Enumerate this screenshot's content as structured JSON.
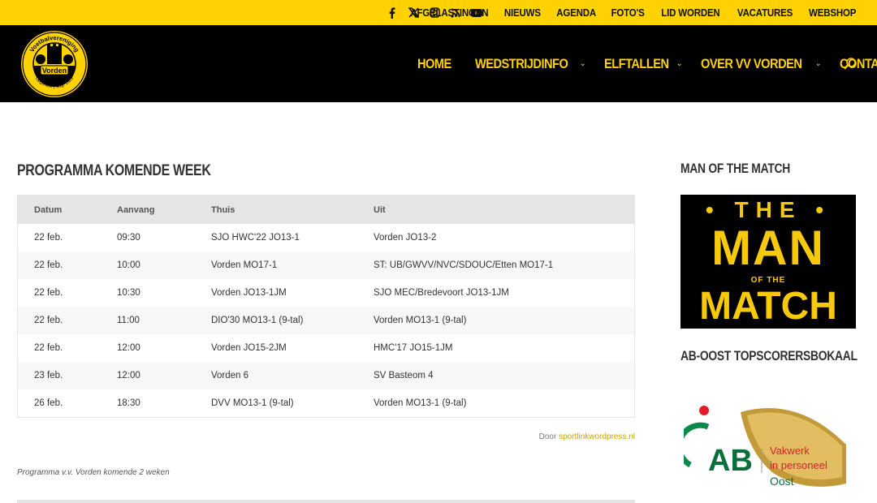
{
  "social": [
    "facebook-icon",
    "x-icon",
    "instagram-icon",
    "rss-icon",
    "youtube-icon"
  ],
  "top_menu": [
    "AFGELASTINGEN",
    "NIEUWS",
    "AGENDA",
    "FOTO'S",
    "LID WORDEN",
    "VACATURES",
    "WEBSHOP"
  ],
  "logo": {
    "top_text": "Voetbalvereniging",
    "name": "Vorden",
    "bottom_text": "Opgericht 1 aug. 1929"
  },
  "main_nav": [
    {
      "label": "HOME",
      "dropdown": false
    },
    {
      "label": "WEDSTRIJDINFO",
      "dropdown": true
    },
    {
      "label": "ELFTALLEN",
      "dropdown": true
    },
    {
      "label": "OVER VV VORDEN",
      "dropdown": true
    },
    {
      "label": "CONTACT",
      "dropdown": true
    }
  ],
  "content": {
    "title": "PROGRAMMA KOMENDE WEEK",
    "columns": [
      "Datum",
      "Aanvang",
      "Thuis",
      "Uit"
    ],
    "rows": [
      [
        "22 feb.",
        "09:30",
        "SJO HWC'22 JO13-1",
        "Vorden JO13-2"
      ],
      [
        "22 feb.",
        "10:00",
        "Vorden MO17-1",
        "ST: UB/GWVV/NVC/SDOUC/Etten MO17-1"
      ],
      [
        "22 feb.",
        "10:30",
        "Vorden JO13-1JM",
        "SJO MEC/Bredevoort JO13-1JM"
      ],
      [
        "22 feb.",
        "11:00",
        "DIO'30 MO13-1 (9-tal)",
        "Vorden MO13-1 (9-tal)"
      ],
      [
        "22 feb.",
        "12:00",
        "Vorden JO15-2JM",
        "HMC'17 JO15-1JM"
      ],
      [
        "23 feb.",
        "12:00",
        "Vorden 6",
        "SV Basteom 4"
      ],
      [
        "26 feb.",
        "18:30",
        "DVV MO13-1 (9-tal)",
        "Vorden MO13-1 (9-tal)"
      ]
    ],
    "credit_prefix": "Door",
    "credit_link": "sportlinkwordpress.nl",
    "caption": "Programma v.v. Vorden komende 2 weken"
  },
  "sidebar": {
    "motm_title": "MAN OF THE MATCH",
    "motm_image": {
      "the": "THE",
      "man": "MAN",
      "of_the": "OF THE",
      "match": "MATCH"
    },
    "topscorer_title": "AB-OOST TOPSCORERSBOKAAL",
    "ab_logo": {
      "letters": "AB",
      "tagline_1": "Vakwerk",
      "tagline_2": "in personeel",
      "region": "Oost"
    }
  },
  "colors": {
    "accent": "#ffd200",
    "header_bg": "#000000",
    "link": "#c8a000"
  }
}
